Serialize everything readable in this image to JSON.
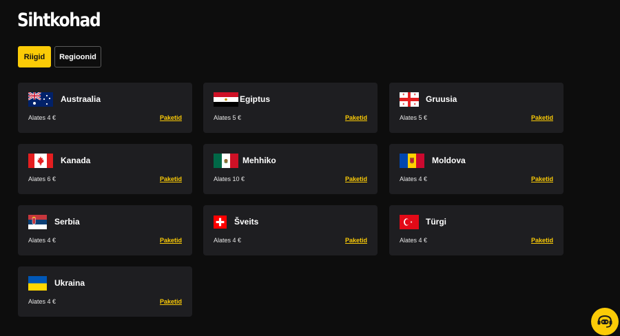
{
  "page": {
    "title": "Sihtkohad"
  },
  "tabs": [
    {
      "label": "Riigid",
      "active": true
    },
    {
      "label": "Regioonid",
      "active": false
    }
  ],
  "destinations": [
    {
      "name": "Austraalia",
      "price": "Alates 4 €",
      "link": "Paketid",
      "flag": "australia-flag"
    },
    {
      "name": "Egiptus",
      "price": "Alates 5 €",
      "link": "Paketid",
      "flag": "egypt-flag"
    },
    {
      "name": "Gruusia",
      "price": "Alates 5 €",
      "link": "Paketid",
      "flag": "georgia-flag"
    },
    {
      "name": "Kanada",
      "price": "Alates 6 €",
      "link": "Paketid",
      "flag": "canada-flag"
    },
    {
      "name": "Mehhiko",
      "price": "Alates 10 €",
      "link": "Paketid",
      "flag": "mexico-flag"
    },
    {
      "name": "Moldova",
      "price": "Alates 4 €",
      "link": "Paketid",
      "flag": "moldova-flag"
    },
    {
      "name": "Serbia",
      "price": "Alates 4 €",
      "link": "Paketid",
      "flag": "serbia-flag"
    },
    {
      "name": "Šveits",
      "price": "Alates 4 €",
      "link": "Paketid",
      "flag": "switzerland-flag"
    },
    {
      "name": "Türgi",
      "price": "Alates 4 €",
      "link": "Paketid",
      "flag": "turkey-flag"
    },
    {
      "name": "Ukraina",
      "price": "Alates 4 €",
      "link": "Paketid",
      "flag": "ukraine-flag"
    }
  ],
  "chat_widget": {
    "icon": "chat-assistant-icon"
  },
  "colors": {
    "accent": "#fbcb07",
    "background": "#0d0d0d",
    "card": "#1e1e21"
  }
}
